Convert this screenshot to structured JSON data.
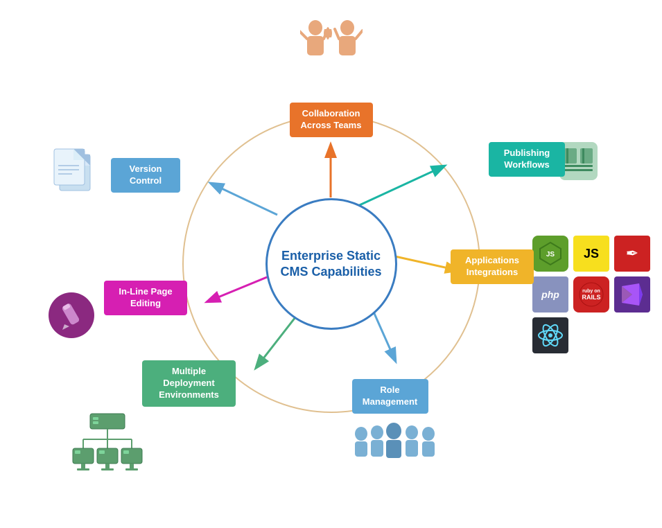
{
  "diagram": {
    "title": "Enterprise Static CMS Capabilities",
    "center_text": "Enterprise Static\nCMS\nCapabilities",
    "capabilities": [
      {
        "id": "collaboration",
        "label": "Collaboration\nAcross Teams",
        "color": "#e8732a",
        "position": "top"
      },
      {
        "id": "publishing",
        "label": "Publishing\nWorkflows",
        "color": "#1ab5a3",
        "position": "top-right"
      },
      {
        "id": "applications",
        "label": "Applications\nIntegrations",
        "color": "#f0b429",
        "position": "right"
      },
      {
        "id": "role",
        "label": "Role\nManagement",
        "color": "#5ba5d6",
        "position": "bottom-right"
      },
      {
        "id": "deployment",
        "label": "Multiple\nDeployment\nEnvironments",
        "color": "#4caf7d",
        "position": "bottom-left"
      },
      {
        "id": "editing",
        "label": "In-Line Page\nEditing",
        "color": "#d61fb2",
        "position": "left"
      },
      {
        "id": "version",
        "label": "Version\nControl",
        "color": "#5ba5d6",
        "position": "top-left"
      }
    ],
    "tech_logos": [
      {
        "label": "JS",
        "bg": "#5d9e2b",
        "text_color": "#fff",
        "shape": "hexagon"
      },
      {
        "label": "JS",
        "bg": "#f7df1e",
        "text_color": "#000",
        "shape": "square"
      },
      {
        "label": "✒",
        "bg": "#cc2222",
        "text_color": "#fff",
        "shape": "feather"
      },
      {
        "label": "php",
        "bg": "#8892be",
        "text_color": "#fff",
        "shape": "square"
      },
      {
        "label": "Rails",
        "bg": "#cc2222",
        "text_color": "#fff",
        "shape": "square"
      },
      {
        "label": "VS",
        "bg": "#5c2d91",
        "text_color": "#fff",
        "shape": "square"
      },
      {
        "label": "⚛",
        "bg": "#61dafb",
        "text_color": "#222",
        "shape": "square"
      }
    ]
  }
}
